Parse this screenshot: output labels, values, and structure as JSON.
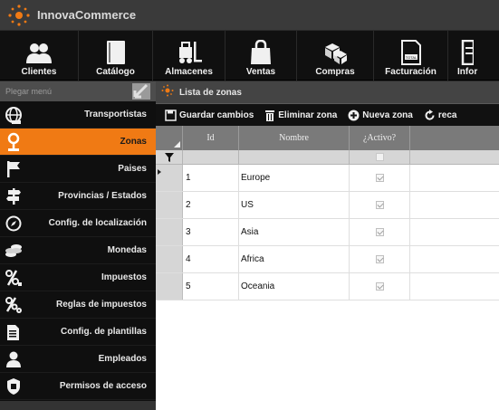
{
  "app": {
    "title": "InnovaCommerce"
  },
  "top_menu": [
    {
      "label": "Clientes",
      "icon": "users-icon"
    },
    {
      "label": "Catálogo",
      "icon": "book-icon"
    },
    {
      "label": "Almacenes",
      "icon": "forklift-icon"
    },
    {
      "label": "Ventas",
      "icon": "shopping-bag-icon"
    },
    {
      "label": "Compras",
      "icon": "boxes-icon"
    },
    {
      "label": "Facturación",
      "icon": "invoice-icon"
    },
    {
      "label": "Infor",
      "icon": "report-icon"
    }
  ],
  "sidebar": {
    "collapse_label": "Plegar menú",
    "items": [
      {
        "label": "Transportistas",
        "icon": "globe-icon"
      },
      {
        "label": "Zonas",
        "icon": "map-pin-icon",
        "active": true
      },
      {
        "label": "Paises",
        "icon": "flag-icon"
      },
      {
        "label": "Provincias / Estados",
        "icon": "signpost-icon"
      },
      {
        "label": "Config. de localización",
        "icon": "compass-icon"
      },
      {
        "label": "Monedas",
        "icon": "coins-icon"
      },
      {
        "label": "Impuestos",
        "icon": "percent-icon"
      },
      {
        "label": "Reglas de impuestos",
        "icon": "percent-gear-icon"
      },
      {
        "label": "Config. de plantillas",
        "icon": "template-icon"
      },
      {
        "label": "Empleados",
        "icon": "user-icon"
      },
      {
        "label": "Permisos de acceso",
        "icon": "shield-icon"
      }
    ]
  },
  "panel": {
    "title": "Lista de zonas",
    "toolbar": {
      "save_label": "Guardar cambios",
      "delete_label": "Eliminar zona",
      "new_label": "Nueva zona",
      "reload_label": "reca"
    }
  },
  "grid": {
    "columns": [
      "Id",
      "Nombre",
      "¿Activo?"
    ],
    "rows": [
      {
        "id": "1",
        "nombre": "Europe",
        "activo": true
      },
      {
        "id": "2",
        "nombre": "US",
        "activo": true
      },
      {
        "id": "3",
        "nombre": "Asia",
        "activo": true
      },
      {
        "id": "4",
        "nombre": "Africa",
        "activo": true
      },
      {
        "id": "5",
        "nombre": "Oceania",
        "activo": true
      }
    ]
  },
  "colors": {
    "accent": "#f07a14",
    "menu_bg": "#101010",
    "header_bg": "#3a3a3a"
  }
}
